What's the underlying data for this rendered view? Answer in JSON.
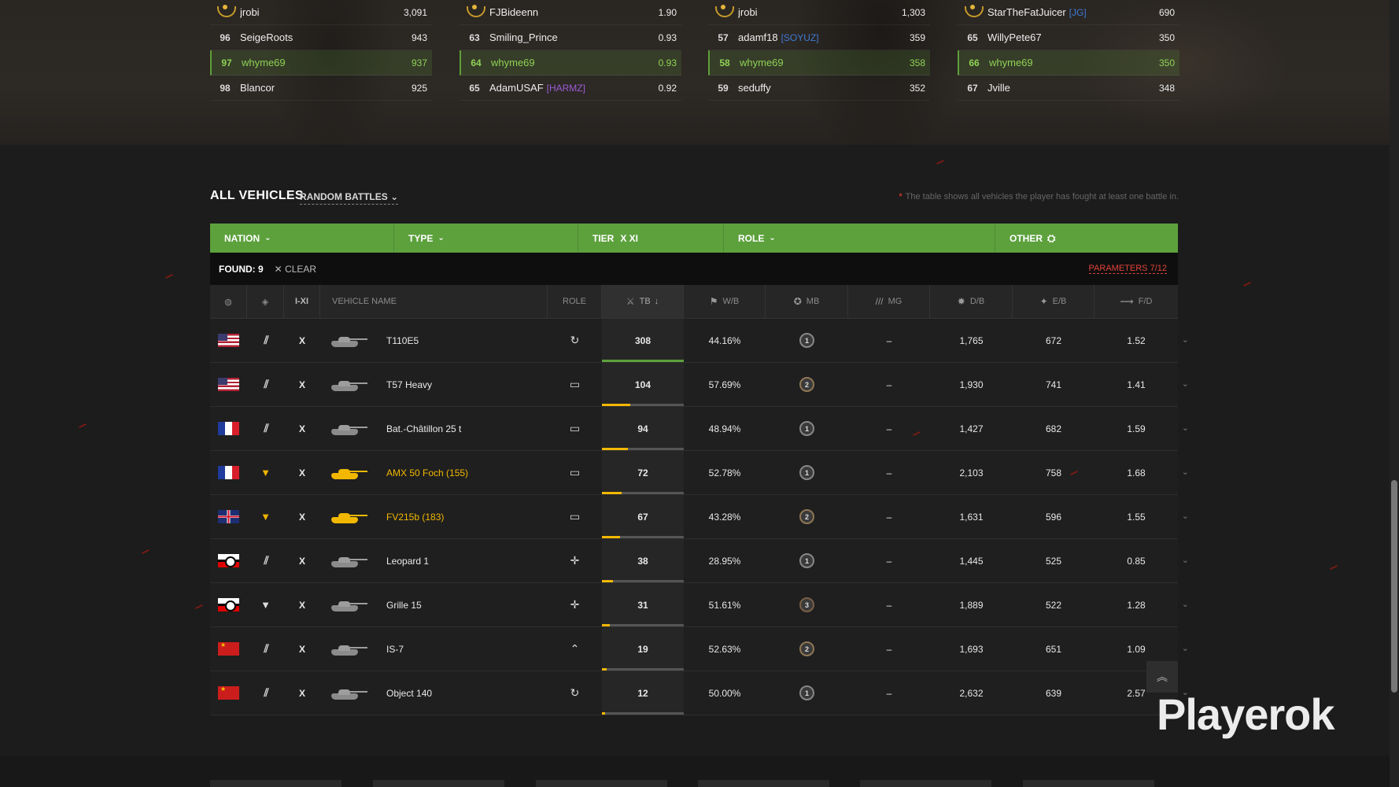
{
  "leaderboards": [
    {
      "rows": [
        {
          "rank": "",
          "laurel": true,
          "name": "jrobi",
          "clan": "",
          "value": "3,091",
          "me": false
        },
        {
          "rank": "96",
          "name": "SeigeRoots",
          "clan": "",
          "value": "943",
          "me": false
        },
        {
          "rank": "97",
          "name": "whyme69",
          "clan": "",
          "value": "937",
          "me": true
        },
        {
          "rank": "98",
          "name": "Blancor",
          "clan": "",
          "value": "925",
          "me": false
        }
      ]
    },
    {
      "rows": [
        {
          "rank": "",
          "laurel": true,
          "name": "FJBideenn",
          "clan": "",
          "value": "1.90",
          "me": false
        },
        {
          "rank": "63",
          "name": "Smiling_Prince",
          "clan": "",
          "value": "0.93",
          "me": false
        },
        {
          "rank": "64",
          "name": "whyme69",
          "clan": "",
          "value": "0.93",
          "me": true
        },
        {
          "rank": "65",
          "name": "AdamUSAF",
          "clan": "[HARMZ]",
          "clanColor": "#9b5cd6",
          "value": "0.92",
          "me": false
        }
      ]
    },
    {
      "rows": [
        {
          "rank": "",
          "laurel": true,
          "name": "jrobi",
          "clan": "",
          "value": "1,303",
          "me": false
        },
        {
          "rank": "57",
          "name": "adamf18",
          "clan": "[SOYUZ]",
          "clanColor": "#3f7bd6",
          "value": "359",
          "me": false
        },
        {
          "rank": "58",
          "name": "whyme69",
          "clan": "",
          "value": "358",
          "me": true
        },
        {
          "rank": "59",
          "name": "seduffy",
          "clan": "",
          "value": "352",
          "me": false
        }
      ]
    },
    {
      "rows": [
        {
          "rank": "",
          "laurel": true,
          "name": "StarTheFatJuicer",
          "clan": "[JG]",
          "clanColor": "#3f7bd6",
          "value": "690",
          "me": false
        },
        {
          "rank": "65",
          "name": "WillyPete67",
          "clan": "",
          "value": "350",
          "me": false
        },
        {
          "rank": "66",
          "name": "whyme69",
          "clan": "",
          "value": "350",
          "me": true
        },
        {
          "rank": "67",
          "name": "Jville",
          "clan": "",
          "value": "348",
          "me": false
        }
      ]
    }
  ],
  "section": {
    "title": "ALL VEHICLES",
    "mode": "RANDOM BATTLES",
    "footnote": "The table shows all vehicles the player has fought at least one battle in."
  },
  "filters": {
    "nation": "NATION",
    "type": "TYPE",
    "tier": "TIER",
    "tier_value": "X XI",
    "role": "ROLE",
    "other": "OTHER"
  },
  "found": {
    "label": "FOUND: 9",
    "clear": "CLEAR",
    "params": "PARAMETERS 7/12"
  },
  "headers": {
    "tier": "I-XI",
    "name": "VEHICLE NAME",
    "role": "ROLE",
    "tb": "TB",
    "wb": "W/B",
    "mb": "MB",
    "mg": "MG",
    "db": "D/B",
    "eb": "E/B",
    "fd": "F/D"
  },
  "vehicles": [
    {
      "nation": "usa",
      "cls": "heavy",
      "tier": "X",
      "name": "T110E5",
      "premium": false,
      "role": "assault",
      "tb": "308",
      "tb_frac": 1.0,
      "tb_color": "#5da13d",
      "wb": "44.16%",
      "mb": "1",
      "mbLevel": 1,
      "mg": "–",
      "db": "1,765",
      "eb": "672",
      "fd": "1.52"
    },
    {
      "nation": "usa",
      "cls": "heavy",
      "tier": "X",
      "name": "T57 Heavy",
      "premium": false,
      "role": "sniper",
      "tb": "104",
      "tb_frac": 0.35,
      "tb_color": "#f2b800",
      "wb": "57.69%",
      "mb": "2",
      "mbLevel": 2,
      "mg": "–",
      "db": "1,930",
      "eb": "741",
      "fd": "1.41"
    },
    {
      "nation": "france",
      "cls": "medium",
      "tier": "X",
      "name": "Bat.-Châtillon 25 t",
      "premium": false,
      "role": "sniper",
      "tb": "94",
      "tb_frac": 0.32,
      "tb_color": "#f2b800",
      "wb": "48.94%",
      "mb": "1",
      "mbLevel": 1,
      "mg": "–",
      "db": "1,427",
      "eb": "682",
      "fd": "1.59"
    },
    {
      "nation": "france",
      "cls": "td",
      "tier": "X",
      "name": "AMX 50 Foch (155)",
      "premium": true,
      "role": "sniper",
      "tb": "72",
      "tb_frac": 0.24,
      "tb_color": "#f2b800",
      "wb": "52.78%",
      "mb": "1",
      "mbLevel": 1,
      "mg": "–",
      "db": "2,103",
      "eb": "758",
      "fd": "1.68"
    },
    {
      "nation": "uk",
      "cls": "td",
      "tier": "X",
      "name": "FV215b (183)",
      "premium": true,
      "role": "sniper",
      "tb": "67",
      "tb_frac": 0.22,
      "tb_color": "#f2b800",
      "wb": "43.28%",
      "mb": "2",
      "mbLevel": 2,
      "mg": "–",
      "db": "1,631",
      "eb": "596",
      "fd": "1.55"
    },
    {
      "nation": "germany",
      "cls": "medium",
      "tier": "X",
      "name": "Leopard 1",
      "premium": false,
      "role": "support",
      "tb": "38",
      "tb_frac": 0.13,
      "tb_color": "#f2b800",
      "wb": "28.95%",
      "mb": "1",
      "mbLevel": 1,
      "mg": "–",
      "db": "1,445",
      "eb": "525",
      "fd": "0.85"
    },
    {
      "nation": "germany",
      "cls": "td",
      "tier": "X",
      "name": "Grille 15",
      "premium": false,
      "role": "support",
      "tb": "31",
      "tb_frac": 0.1,
      "tb_color": "#f2b800",
      "wb": "51.61%",
      "mb": "3",
      "mbLevel": 3,
      "mg": "–",
      "db": "1,889",
      "eb": "522",
      "fd": "1.28"
    },
    {
      "nation": "ussr",
      "cls": "heavy",
      "tier": "X",
      "name": "IS-7",
      "premium": false,
      "role": "breakthrough",
      "tb": "19",
      "tb_frac": 0.06,
      "tb_color": "#f2b800",
      "wb": "52.63%",
      "mb": "2",
      "mbLevel": 2,
      "mg": "–",
      "db": "1,693",
      "eb": "651",
      "fd": "1.09"
    },
    {
      "nation": "ussr",
      "cls": "medium",
      "tier": "X",
      "name": "Object 140",
      "premium": false,
      "role": "assault",
      "tb": "12",
      "tb_frac": 0.04,
      "tb_color": "#f2b800",
      "wb": "50.00%",
      "mb": "1",
      "mbLevel": 1,
      "mg": "–",
      "db": "2,632",
      "eb": "639",
      "fd": "2.57"
    }
  ],
  "icons": {
    "heavy": "heavy-tank-icon",
    "medium": "medium-tank-icon",
    "td": "tank-destroyer-icon",
    "role_assault": "assault-role-icon",
    "role_sniper": "sniper-role-icon",
    "role_support": "support-role-icon",
    "role_breakthrough": "breakthrough-role-icon"
  },
  "watermark": "Playerok",
  "colors": {
    "accent": "#5da13d",
    "premium": "#f2b800",
    "me": "#8fd256",
    "link": "#e0443a"
  }
}
